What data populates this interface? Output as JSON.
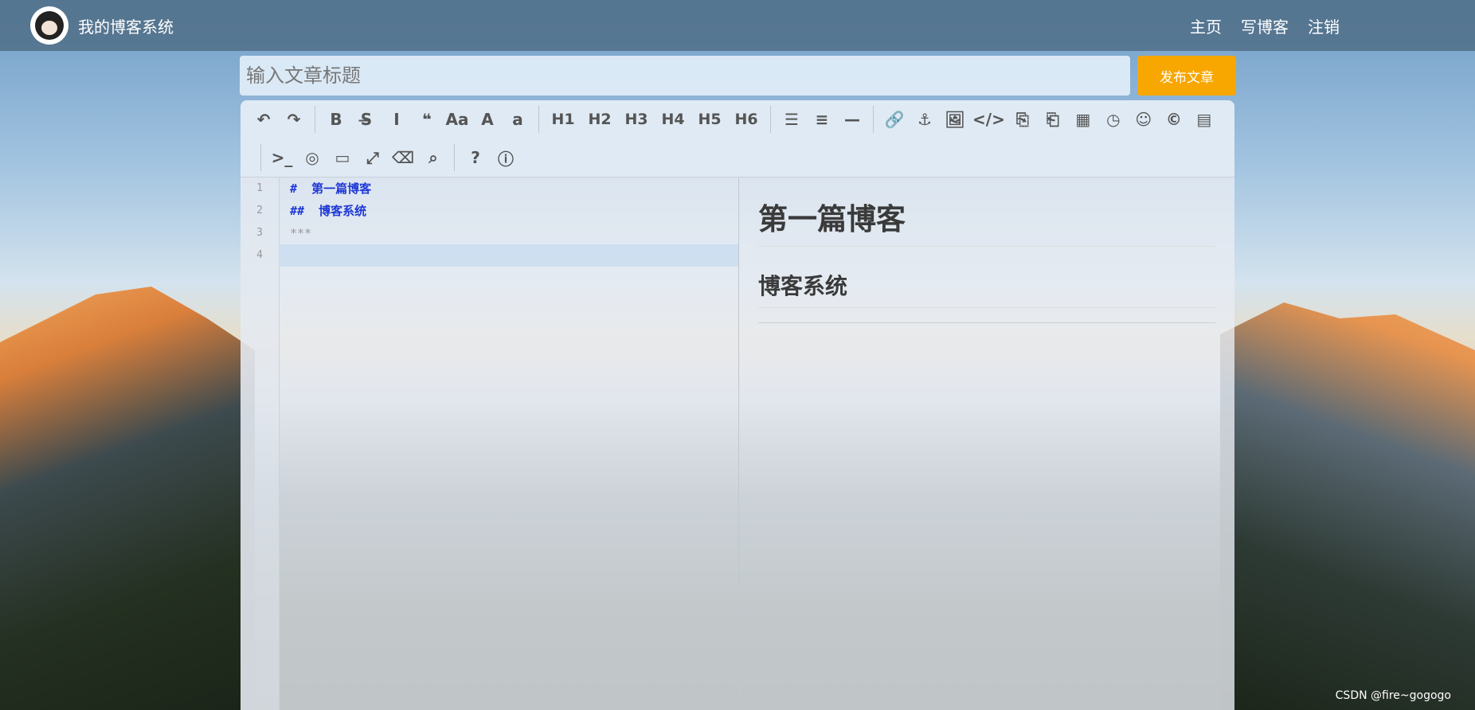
{
  "navbar": {
    "brand": "我的博客系统",
    "links": [
      "主页",
      "写博客",
      "注销"
    ]
  },
  "title_input": {
    "placeholder": "输入文章标题",
    "value": ""
  },
  "publish_button": "发布文章",
  "toolbar": {
    "row1": [
      {
        "name": "undo-icon",
        "glyph": "↶"
      },
      {
        "name": "redo-icon",
        "glyph": "↷"
      },
      {
        "sep": true
      },
      {
        "name": "bold-icon",
        "glyph": "B"
      },
      {
        "name": "strikethrough-icon",
        "glyph": "S̶"
      },
      {
        "name": "italic-icon",
        "glyph": "I"
      },
      {
        "name": "quote-icon",
        "glyph": "❝"
      },
      {
        "name": "uppercase-icon",
        "glyph": "Aa"
      },
      {
        "name": "font-size-icon",
        "glyph": "A"
      },
      {
        "name": "lowercase-icon",
        "glyph": "a"
      },
      {
        "sep": true
      },
      {
        "name": "h1-button",
        "glyph": "H1",
        "hx": true
      },
      {
        "name": "h2-button",
        "glyph": "H2",
        "hx": true
      },
      {
        "name": "h3-button",
        "glyph": "H3",
        "hx": true
      },
      {
        "name": "h4-button",
        "glyph": "H4",
        "hx": true
      },
      {
        "name": "h5-button",
        "glyph": "H5",
        "hx": true
      },
      {
        "name": "h6-button",
        "glyph": "H6",
        "hx": true
      },
      {
        "sep": true
      },
      {
        "name": "unordered-list-icon",
        "glyph": "☰"
      },
      {
        "name": "ordered-list-icon",
        "glyph": "≡"
      },
      {
        "name": "horizontal-rule-icon",
        "glyph": "—"
      },
      {
        "sep": true
      },
      {
        "name": "link-icon",
        "glyph": "🔗"
      },
      {
        "name": "anchor-icon",
        "glyph": "⚓"
      },
      {
        "name": "image-icon",
        "glyph": "🖼"
      },
      {
        "name": "code-icon",
        "glyph": "</>"
      },
      {
        "name": "code-block-icon",
        "glyph": "⎘"
      },
      {
        "name": "code-file-icon",
        "glyph": "⎗"
      },
      {
        "name": "table-icon",
        "glyph": "▦"
      },
      {
        "name": "datetime-icon",
        "glyph": "◷"
      },
      {
        "name": "emoji-icon",
        "glyph": "☺"
      },
      {
        "name": "html-entities-icon",
        "glyph": "©"
      },
      {
        "name": "pagebreak-icon",
        "glyph": "▤"
      }
    ],
    "row2": [
      {
        "sep": true
      },
      {
        "name": "terminal-icon",
        "glyph": ">_"
      },
      {
        "name": "hide-preview-icon",
        "glyph": "◎"
      },
      {
        "name": "desktop-preview-icon",
        "glyph": "▭"
      },
      {
        "name": "fullscreen-icon",
        "glyph": "⤢"
      },
      {
        "name": "eraser-icon",
        "glyph": "⌫"
      },
      {
        "name": "search-icon",
        "glyph": "⌕"
      },
      {
        "sep": true
      },
      {
        "name": "help-icon",
        "glyph": "?"
      },
      {
        "name": "info-icon",
        "glyph": "ⓘ"
      }
    ]
  },
  "editor": {
    "line_numbers": [
      "1",
      "2",
      "3",
      "4"
    ],
    "lines": [
      "#  第一篇博客",
      "##  博客系统",
      "***",
      ""
    ]
  },
  "preview": {
    "h1": "第一篇博客",
    "h2": "博客系统"
  },
  "watermark": "CSDN @fire~gogogo"
}
